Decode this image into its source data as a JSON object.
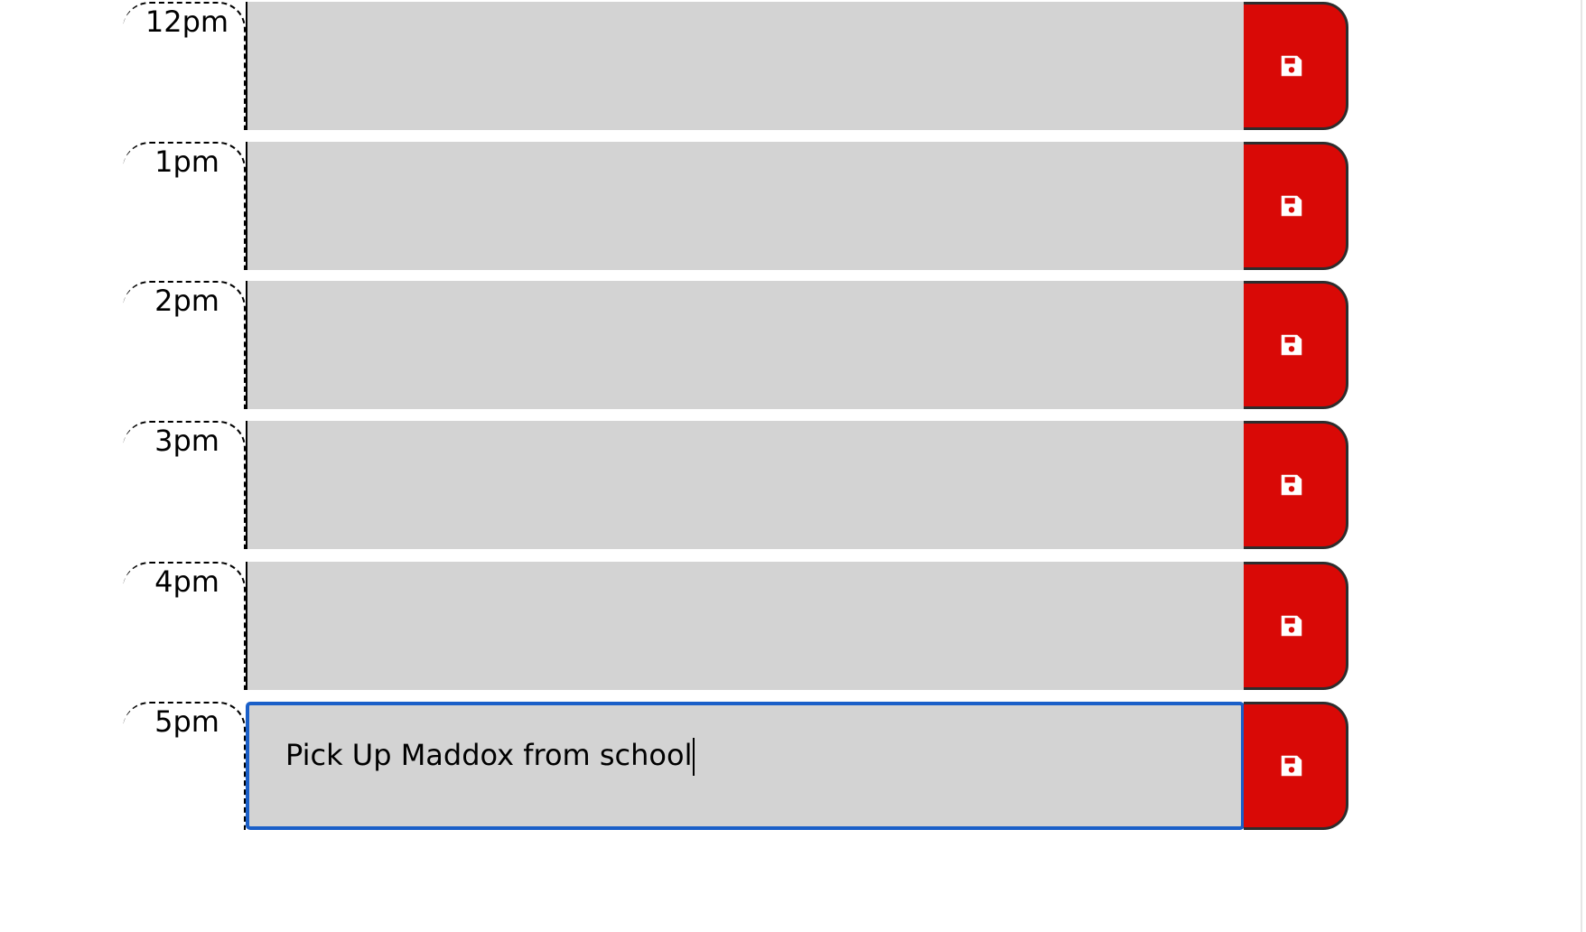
{
  "planner": {
    "blocks": [
      {
        "hour": "12pm",
        "event": ""
      },
      {
        "hour": "1pm",
        "event": ""
      },
      {
        "hour": "2pm",
        "event": ""
      },
      {
        "hour": "3pm",
        "event": ""
      },
      {
        "hour": "4pm",
        "event": ""
      },
      {
        "hour": "5pm",
        "event": "Pick Up Maddox from school"
      }
    ]
  },
  "theme": {
    "save_button_color": "#d90906",
    "event_background": "#d3d3d3",
    "focus_border": "#1a5fc8"
  },
  "icons": {
    "save": "floppy-disk-icon"
  }
}
